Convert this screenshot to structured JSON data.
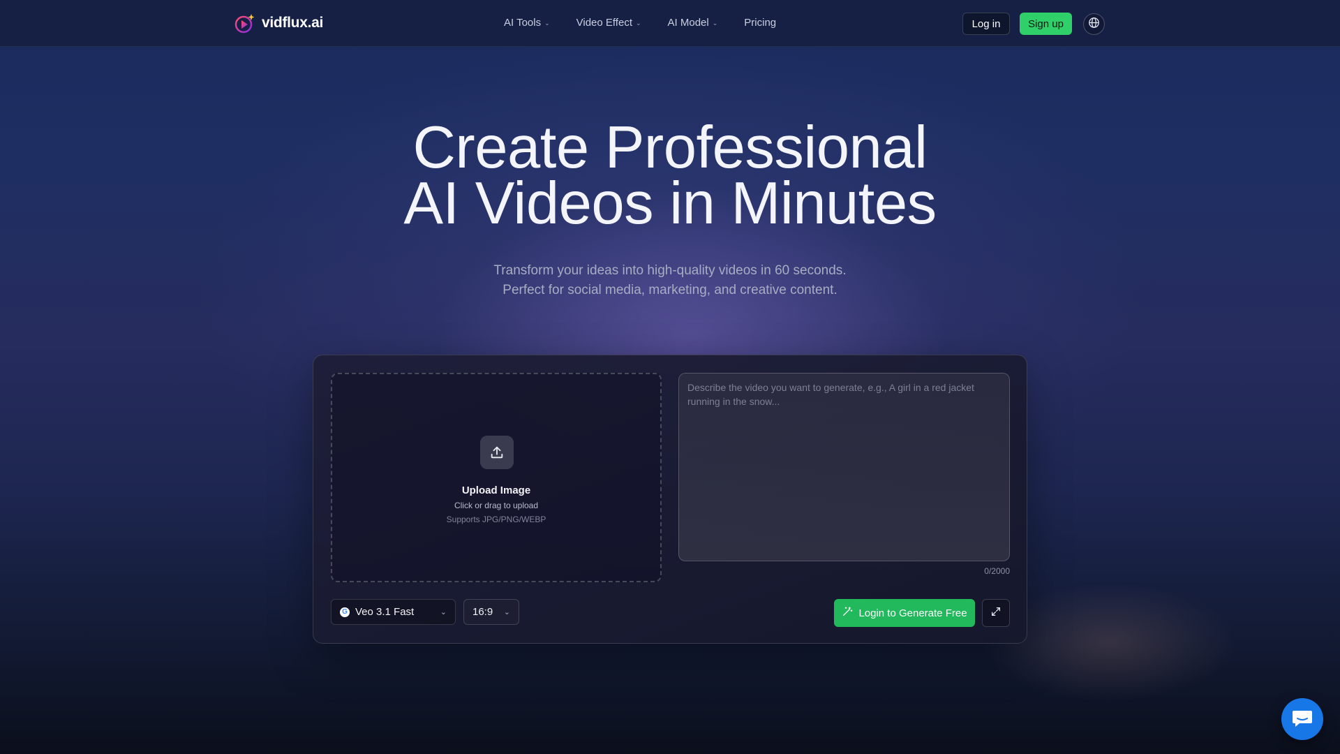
{
  "brand": {
    "name": "vidflux.ai"
  },
  "nav": {
    "items": [
      {
        "label": "AI Tools",
        "has_dropdown": true
      },
      {
        "label": "Video Effect",
        "has_dropdown": true
      },
      {
        "label": "AI Model",
        "has_dropdown": true
      },
      {
        "label": "Pricing",
        "has_dropdown": false
      }
    ],
    "login_label": "Log in",
    "signup_label": "Sign up",
    "language_icon": "globe-icon"
  },
  "hero": {
    "title_line1": "Create Professional",
    "title_line2": "AI Videos in Minutes",
    "subtitle_line1": "Transform your ideas into high-quality videos in 60 seconds.",
    "subtitle_line2": "Perfect for social media, marketing, and creative content."
  },
  "generator": {
    "upload": {
      "icon": "upload-icon",
      "title": "Upload Image",
      "hint": "Click or drag to upload",
      "formats": "Supports JPG/PNG/WEBP"
    },
    "prompt": {
      "value": "",
      "placeholder": "Describe the video you want to generate, e.g., A girl in a red jacket running in the snow...",
      "counter": "0/2000"
    },
    "model": {
      "selected": "Veo 3.1 Fast",
      "provider_icon": "google-icon"
    },
    "aspect_ratio": {
      "selected": "16:9"
    },
    "generate_label": "Login to Generate Free",
    "expand_icon": "expand-icon"
  },
  "chat": {
    "icon": "chat-icon"
  },
  "colors": {
    "accent_green": "#2fcf6a",
    "generate_green": "#22b95c",
    "chat_blue": "#1877e6",
    "nav_bg": "#162042"
  }
}
